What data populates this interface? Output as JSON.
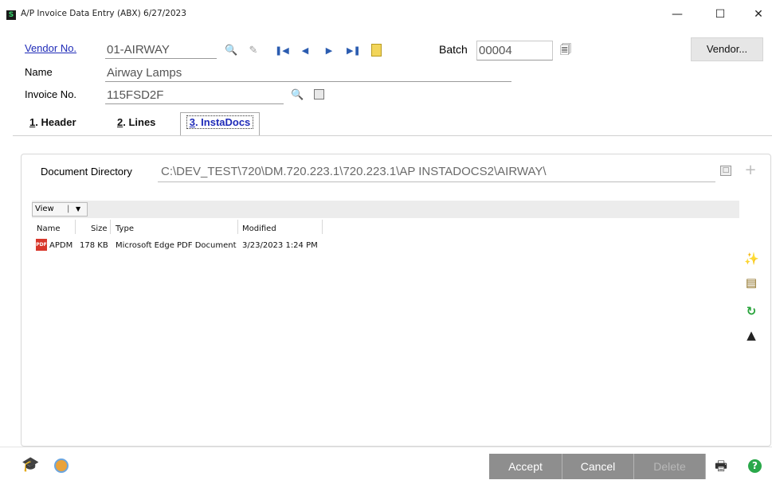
{
  "window": {
    "title": "A/P Invoice Data Entry (ABX) 6/27/2023",
    "icon_letter": "S",
    "minimize": "—",
    "maximize": "☐",
    "close": "✕"
  },
  "header": {
    "vendor_label": "Vendor No.",
    "vendor_value": "01-AIRWAY",
    "name_label": "Name",
    "name_value": "Airway Lamps",
    "invoice_label": "Invoice No.",
    "invoice_value": "115FSD2F",
    "batch_label": "Batch",
    "batch_value": "00004",
    "vendor_button": "Vendor..."
  },
  "tabs": [
    {
      "num": "1",
      "label": ". Header"
    },
    {
      "num": "2",
      "label": ". Lines"
    },
    {
      "num": "3",
      "label": ". InstaDocs"
    }
  ],
  "instadocs": {
    "dir_label": "Document Directory",
    "dir_value": "C:\\DEV_TEST\\720\\DM.720.223.1\\720.223.1\\AP INSTADOCS2\\AIRWAY\\",
    "view_label": "View",
    "columns": [
      "Name",
      "Size",
      "Type",
      "Modified"
    ],
    "rows": [
      {
        "name": "APDM",
        "size": "178 KB",
        "type": "Microsoft Edge PDF Document",
        "modified": "3/23/2023 1:24 PM"
      }
    ],
    "pdf_badge": "PDF"
  },
  "footer": {
    "accept": "Accept",
    "cancel": "Cancel",
    "delete": "Delete"
  },
  "icons": {
    "lookup": "search-icon",
    "clear": "eraser-icon",
    "first": "first-record-icon",
    "prev": "previous-record-icon",
    "next": "next-record-icon",
    "last": "last-record-icon",
    "memo": "memo-icon",
    "batch": "batch-icon",
    "calendar": "calendar-icon",
    "folder": "folder-browse-icon",
    "add": "add-icon",
    "wizard": "wizard-icon",
    "binoculars": "binoculars-icon",
    "refresh": "refresh-icon",
    "upload": "upload-icon",
    "learn": "learning-icon",
    "chart": "chart-icon",
    "print": "printer-icon",
    "help": "help-icon"
  }
}
